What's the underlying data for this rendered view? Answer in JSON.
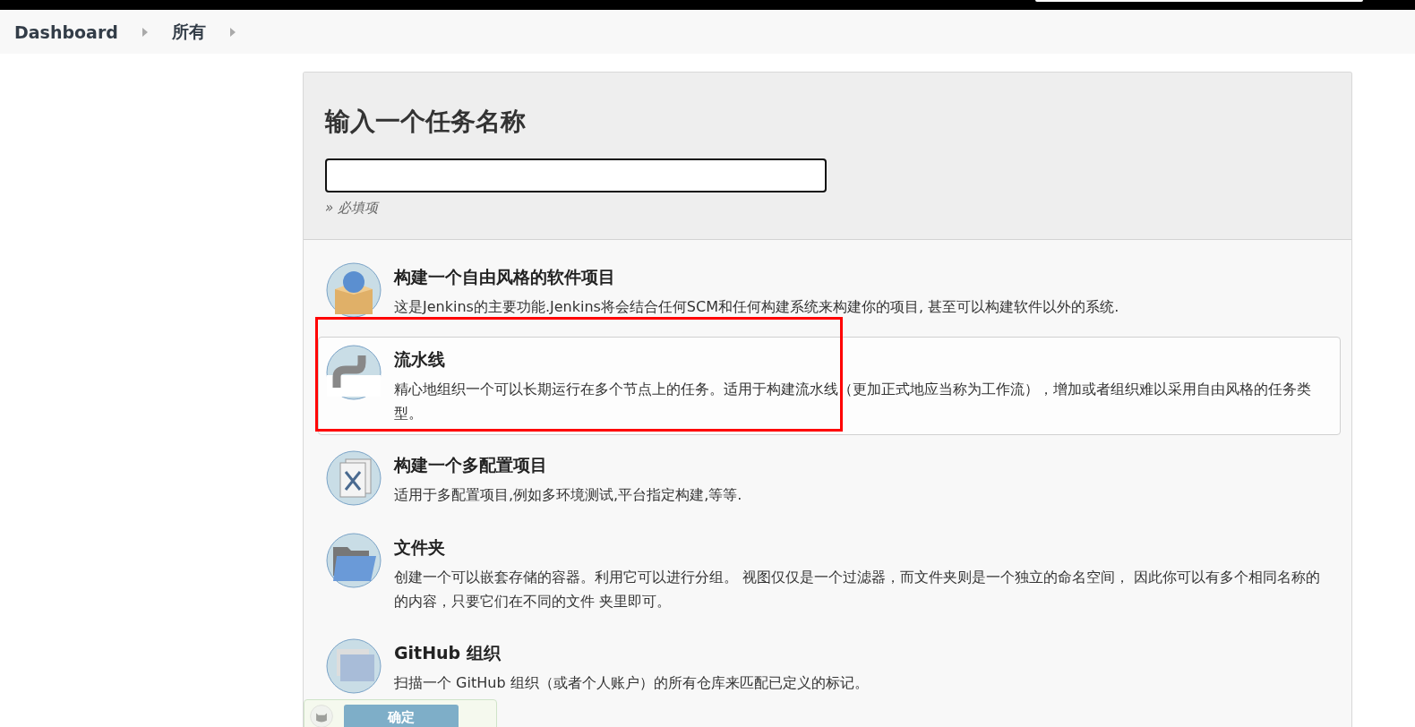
{
  "breadcrumbs": [
    {
      "label": "Dashboard"
    },
    {
      "label": "所有"
    }
  ],
  "form": {
    "title": "输入一个任务名称",
    "name_field": {
      "focused": true
    },
    "hint": "» 必填项"
  },
  "items": [
    {
      "kind": "freestyle",
      "title": "构建一个自由风格的软件项目",
      "description": "这是Jenkins的主要功能.Jenkins将会结合任何SCM和任何构建系统来构建你的项目, 甚至可以构建软件以外的系统.",
      "selected": false,
      "annotated": false
    },
    {
      "kind": "pipeline",
      "title": "流水线",
      "description": "精心地组织一个可以长期运行在多个节点上的任务。适用于构建流水线（更加正式地应当称为工作流），增加或者组织难以采用自由风格的任务类型。",
      "selected": true,
      "annotated": true
    },
    {
      "kind": "multiconfig",
      "title": "构建一个多配置项目",
      "description": "适用于多配置项目,例如多环境测试,平台指定构建,等等.",
      "selected": false,
      "annotated": false
    },
    {
      "kind": "folder",
      "title": "文件夹",
      "description": "创建一个可以嵌套存储的容器。利用它可以进行分组。 视图仅仅是一个过滤器，而文件夹则是一个独立的命名空间， 因此你可以有多个相同名称的的内容，只要它们在不同的文件 夹里即可。",
      "selected": false,
      "annotated": false
    },
    {
      "kind": "org",
      "title": "GitHub 组织",
      "description": "扫描一个 GitHub 组织（或者个人账户）的所有仓库来匹配已定义的标记。",
      "selected": false,
      "annotated": false
    }
  ],
  "footer": {
    "button": "确定"
  }
}
